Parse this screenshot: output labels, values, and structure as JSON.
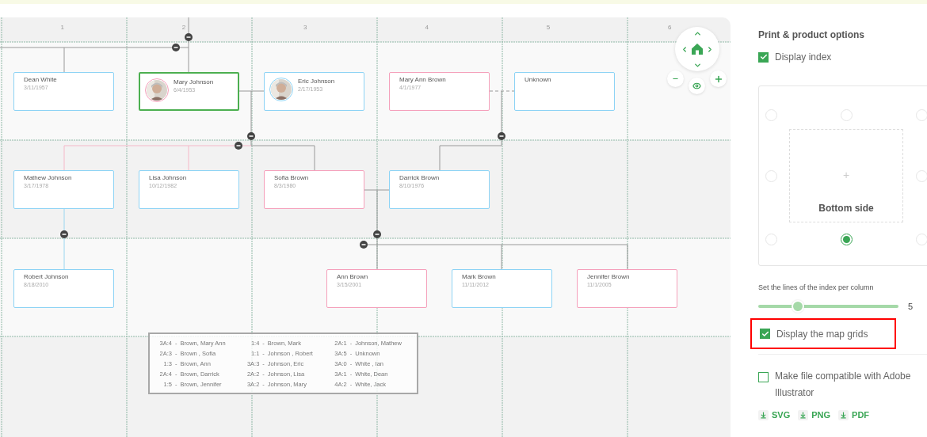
{
  "canvas": {
    "column_labels": [
      "1",
      "2",
      "3",
      "4",
      "5",
      "6"
    ],
    "cards": [
      {
        "name": "Dean White",
        "date": "3/11/1957",
        "color": "#8dd3f5",
        "selected": false,
        "photo": false
      },
      {
        "name": "Mary Johnson",
        "date": "6/4/1953",
        "color": "#f5a0bb",
        "selected": true,
        "photo": true
      },
      {
        "name": "Eric Johnson",
        "date": "2/17/1953",
        "color": "#8dd3f5",
        "selected": false,
        "photo": true
      },
      {
        "name": "Mary Ann Brown",
        "date": "4/1/1977",
        "color": "#f5a0bb",
        "selected": false,
        "photo": false
      },
      {
        "name": "Unknown",
        "color": "#8dd3f5",
        "selected": false,
        "photo": false
      },
      {
        "name": "Mathew Johnson",
        "date": "3/17/1978",
        "color": "#8dd3f5",
        "selected": false,
        "photo": false
      },
      {
        "name": "Lisa Johnson",
        "date": "10/12/1982",
        "color": "#8dd3f5",
        "selected": false,
        "photo": false
      },
      {
        "name": "Sofia Brown",
        "date": "8/3/1980",
        "color": "#f5a0bb",
        "selected": false,
        "photo": false
      },
      {
        "name": "Darrick Brown",
        "date": "8/10/1976",
        "color": "#8dd3f5",
        "selected": false,
        "photo": false
      },
      {
        "name": "Robert Johnson",
        "date": "8/18/2010",
        "color": "#8dd3f5",
        "selected": false,
        "photo": false
      },
      {
        "name": "Ann Brown",
        "date": "3/15/2001",
        "color": "#f5a0bb",
        "selected": false,
        "photo": false
      },
      {
        "name": "Mark Brown",
        "date": "11/11/2012",
        "color": "#8dd3f5",
        "selected": false,
        "photo": false
      },
      {
        "name": "Jennifer Brown",
        "date": "11/1/2005",
        "color": "#f5a0bb",
        "selected": false,
        "photo": false
      }
    ],
    "index_legend": {
      "separator": "-",
      "columns": [
        [
          {
            "code": "3A:4",
            "name": "Brown, Mary Ann"
          },
          {
            "code": "2A:3",
            "name": "Brown , Sofia"
          },
          {
            "code": "1:3",
            "name": "Brown, Ann"
          },
          {
            "code": "2A:4",
            "name": "Brown, Darrick"
          },
          {
            "code": "1:5",
            "name": "Brown, Jennifer"
          }
        ],
        [
          {
            "code": "1:4",
            "name": "Brown, Mark"
          },
          {
            "code": "1:1",
            "name": "Johnson , Robert"
          },
          {
            "code": "3A:3",
            "name": "Johnson, Eric"
          },
          {
            "code": "2A:2",
            "name": "Johnson, Lisa"
          },
          {
            "code": "3A:2",
            "name": "Johnson, Mary"
          }
        ],
        [
          {
            "code": "2A:1",
            "name": "Johnson, Mathew"
          },
          {
            "code": "3A:5",
            "name": "Unknown"
          },
          {
            "code": "3A:0",
            "name": "White , Ian"
          },
          {
            "code": "3A:1",
            "name": "White, Dean"
          },
          {
            "code": "4A:2",
            "name": "White, Jack"
          }
        ]
      ]
    }
  },
  "options_panel": {
    "title": "Print & product options",
    "display_index": {
      "label": "Display index",
      "checked": true
    },
    "index_position": {
      "center_mark": "+",
      "label": "Bottom side",
      "options": [
        {
          "selected": false
        },
        {
          "selected": false
        },
        {
          "selected": false
        },
        {
          "selected": false
        },
        {
          "selected": false
        },
        {
          "selected": false
        },
        {
          "selected": true
        },
        {
          "selected": false
        }
      ]
    },
    "lines_slider": {
      "label": "Set the lines of the index per column",
      "level": 0.28,
      "value": "5"
    },
    "map_grids": {
      "label": "Display the map grids",
      "checked": true,
      "highlighted": true
    },
    "illustrator": {
      "label": "Make file compatible with Adobe Illustrator",
      "checked": false
    },
    "downloads": [
      "SVG",
      "PNG",
      "PDF"
    ]
  }
}
